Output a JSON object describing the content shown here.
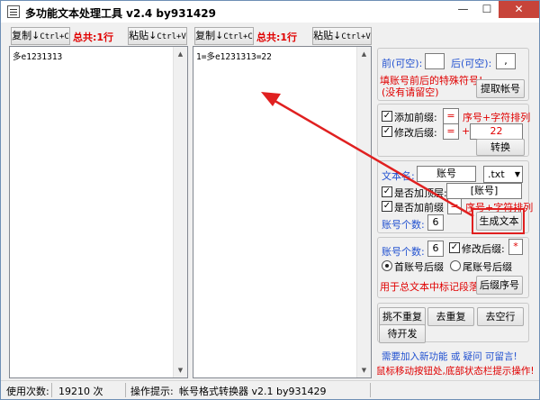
{
  "window": {
    "title": "多功能文本处理工具 v2.4 by931429",
    "minimize": "—",
    "maximize": "☐",
    "close": "✕"
  },
  "left_pane": {
    "copy_label": "复制",
    "copy_hotkey": "Ctrl+C",
    "total_label": "总共:1行",
    "paste_label": "粘贴",
    "paste_hotkey": "Ctrl+V",
    "content": "多e1231313"
  },
  "right_pane": {
    "copy_label": "复制",
    "copy_hotkey": "Ctrl+C",
    "total_label": "总共:1行",
    "paste_label": "粘贴",
    "paste_hotkey": "Ctrl+V",
    "content": "1=多e1231313=22"
  },
  "panel1": {
    "prefix_label": "前(可空):",
    "prefix_value": "",
    "suffix_label": "后(可空):",
    "suffix_value": ",",
    "hint": "填账号前后的特殊符号!",
    "hint2": "(没有请留空)",
    "extract_button": "提取帐号"
  },
  "panel2": {
    "add_prefix_label": "添加前缀:",
    "add_prefix_value": "=",
    "add_prefix_hint": "序号+字符排列",
    "modify_suffix_label": "修改后缀:",
    "modify_suffix_value": "=",
    "plus": "+",
    "modify_suffix_number": "22",
    "convert_button": "转换"
  },
  "panel3": {
    "filename_label": "文本名:",
    "filename_value": "账号",
    "ext_value": ".txt",
    "add_top_label": "是否加顶层:",
    "add_top_value": "[账号]",
    "add_prefix_label": "是否加前缀",
    "add_prefix_value": "=",
    "add_prefix_hint": "序号+字符排列",
    "count_label": "账号个数:",
    "count_value": "6",
    "generate_button": "生成文本"
  },
  "panel4": {
    "count_label": "账号个数:",
    "count_value": "6",
    "modify_suffix_label": "修改后缀:",
    "modify_suffix_value": "*",
    "radio_first_label": "首账号后缀",
    "radio_last_label": "尾账号后缀",
    "hint": "用于总文本中标记段落",
    "suffix_seq_button": "后缀序号"
  },
  "panel5": {
    "pick_button": "挑不重复",
    "dedupe_button": "去重复",
    "remove_empty_button": "去空行",
    "pending_button": "待开发"
  },
  "footer_notes": {
    "line1": "需要加入新功能 或 疑问 可留言!",
    "line2": "鼠标移动按钮处,底部状态栏提示操作!"
  },
  "statusbar": {
    "usage_label": "使用次数:",
    "usage_value": "19210 次",
    "tip_label": "操作提示:",
    "tip_value": "帐号格式转换器 v2.1 by931429"
  },
  "colors": {
    "annotation_red": "#e02020",
    "label_blue": "#2050d0",
    "label_red": "#e00000"
  }
}
